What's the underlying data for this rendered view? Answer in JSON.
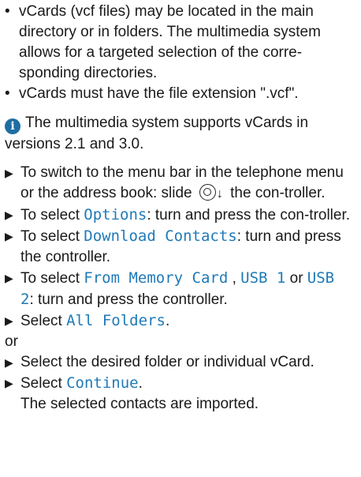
{
  "bullets": [
    "vCards (vcf files) may be located in the main directory or in folders. The multimedia system allows for a targeted selection of the corre-sponding directories.",
    "vCards must have the file extension \".vcf\"."
  ],
  "note": "The multimedia system supports vCards in versions 2.1 and 3.0.",
  "steps": {
    "s1_before": "To switch to the menu bar in the telephone menu or the address book: slide ",
    "s1_after": " the con-troller.",
    "s2_before": "To select ",
    "s2_code": "Options",
    "s2_after": ": turn and press the con-troller.",
    "s3_before": "To select ",
    "s3_code": "Download Contacts",
    "s3_after": ": turn and press the controller.",
    "s4_before": "To select ",
    "s4_code1": "From Memory Card",
    "s4_sep1": " , ",
    "s4_code2": "USB 1",
    "s4_sep2": " or ",
    "s4_code3": "USB 2",
    "s4_after": ": turn and press the controller.",
    "s5_before": "Select ",
    "s5_code": "All Folders",
    "s5_after": ".",
    "or": "or",
    "s6": "Select the desired folder or individual vCard.",
    "s7_before": "Select ",
    "s7_code": "Continue",
    "s7_after": ".",
    "s7_result": "The selected contacts are imported."
  },
  "symbols": {
    "bullet": "•",
    "step_arrow": "▶",
    "info": "i",
    "slide_down": "↓"
  },
  "colors": {
    "menu_text": "#1f7ab7",
    "info_icon": "#1f6ea3"
  },
  "icons": {
    "info": "info-circle-icon",
    "controller": "controller-icon",
    "slide_direction": "slide-down-arrow-icon"
  }
}
